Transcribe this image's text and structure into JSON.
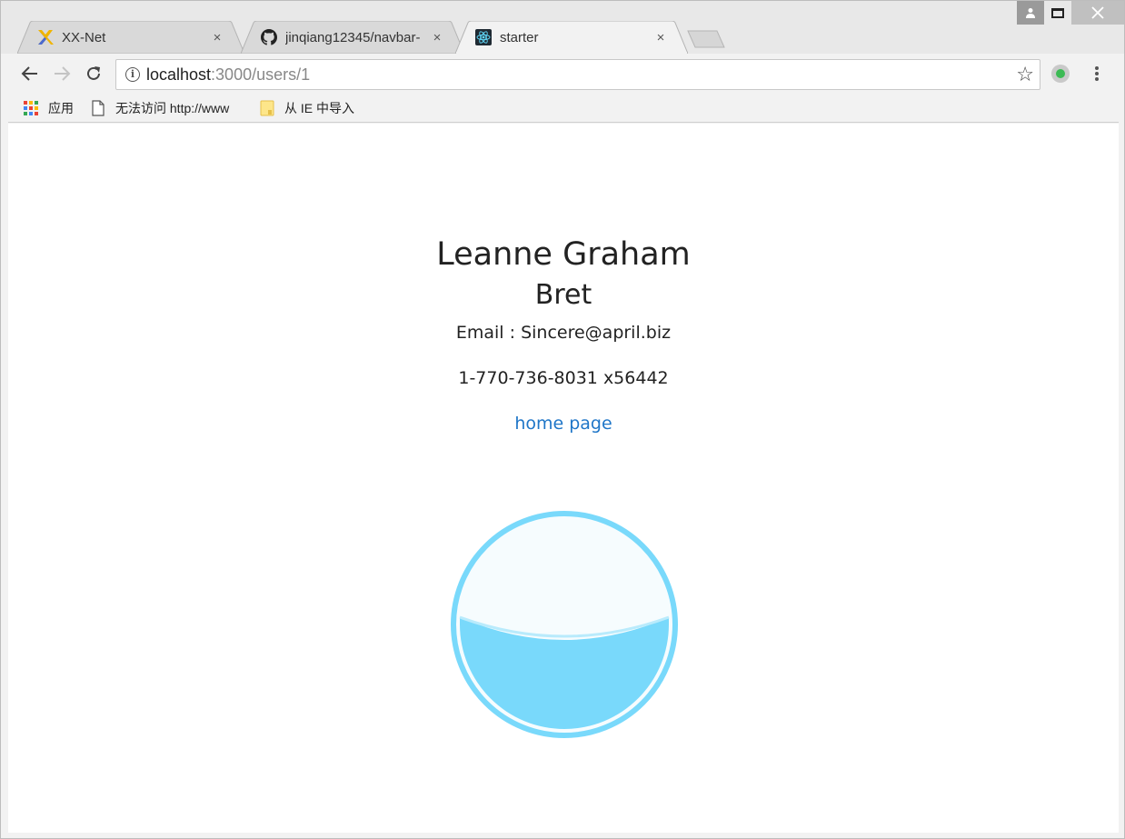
{
  "browser": {
    "tabs": [
      {
        "title": "XX-Net",
        "favicon": "xx-net-icon",
        "active": false
      },
      {
        "title": "jinqiang12345/navbar-",
        "favicon": "github-icon",
        "active": false
      },
      {
        "title": "starter",
        "favicon": "react-icon",
        "active": true
      }
    ],
    "close_glyph": "×",
    "address": {
      "host": "localhost",
      "rest": ":3000/users/1"
    },
    "bookmarks": [
      {
        "label": "应用",
        "icon": "apps-icon"
      },
      {
        "label": "无法访问 http://www",
        "icon": "page-icon"
      },
      {
        "label": "从 IE 中导入",
        "icon": "folder-icon"
      }
    ],
    "colors": {
      "accent": "#1f76c8",
      "extension": "#3cba54"
    }
  },
  "user": {
    "name": "Leanne Graham",
    "username": "Bret",
    "email_line": "Email : Sincere@april.biz",
    "phone": "1-770-736-8031 x56442",
    "homepage_label": "home page"
  },
  "loader": {
    "fill_level": 0.45,
    "color": "#79d9fb"
  }
}
